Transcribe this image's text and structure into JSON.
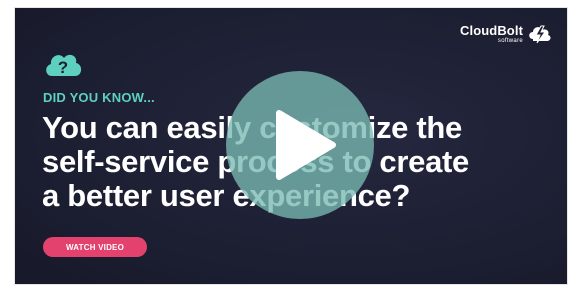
{
  "brand": {
    "name": "CloudBolt",
    "tagline": "software"
  },
  "video": {
    "eyebrow": "DID YOU KNOW...",
    "headline_lines": [
      "You can easily customize the",
      "self-service process to create",
      "a better user experience?"
    ],
    "cta_label": "WATCH VIDEO"
  },
  "icons": {
    "badge": "question-cloud-icon",
    "play": "play-icon",
    "logo": "cloudbolt-logo-icon"
  },
  "colors": {
    "background": "#1d1f33",
    "accent_teal": "#5ed0c0",
    "cta_pink": "#e2426d",
    "play_overlay": "#78bab2"
  }
}
